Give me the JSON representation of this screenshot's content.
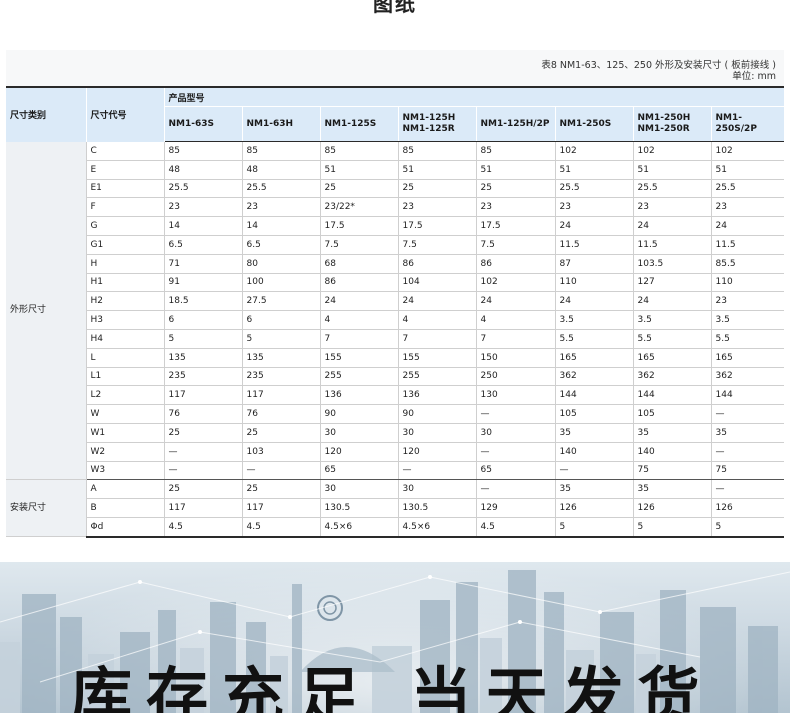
{
  "page_title": "图纸",
  "caption": {
    "title": "表8 NM1-63、125、250 外形及安装尺寸 ( 板前接线 )",
    "unit": "单位:  mm"
  },
  "header": {
    "category_label": "尺寸类别",
    "code_label": "尺寸代号",
    "group_label": "产品型号",
    "models": [
      "NM1-63S",
      "NM1-63H",
      "NM1-125S",
      "NM1-125H NM1-125R",
      "NM1-125H/2P",
      "NM1-250S",
      "NM1-250H NM1-250R",
      "NM1-250S/2P"
    ]
  },
  "sections": [
    {
      "category": "外形尺寸",
      "rows": [
        {
          "code": "C",
          "values": [
            "85",
            "85",
            "85",
            "85",
            "85",
            "102",
            "102",
            "102"
          ]
        },
        {
          "code": "E",
          "values": [
            "48",
            "48",
            "51",
            "51",
            "51",
            "51",
            "51",
            "51"
          ]
        },
        {
          "code": "E1",
          "values": [
            "25.5",
            "25.5",
            "25",
            "25",
            "25",
            "25.5",
            "25.5",
            "25.5"
          ]
        },
        {
          "code": "F",
          "values": [
            "23",
            "23",
            "23/22*",
            "23",
            "23",
            "23",
            "23",
            "23"
          ]
        },
        {
          "code": "G",
          "values": [
            "14",
            "14",
            "17.5",
            "17.5",
            "17.5",
            "24",
            "24",
            "24"
          ]
        },
        {
          "code": "G1",
          "values": [
            "6.5",
            "6.5",
            "7.5",
            "7.5",
            "7.5",
            "11.5",
            "11.5",
            "11.5"
          ]
        },
        {
          "code": "H",
          "values": [
            "71",
            "80",
            "68",
            "86",
            "86",
            "87",
            "103.5",
            "85.5"
          ]
        },
        {
          "code": "H1",
          "values": [
            "91",
            "100",
            "86",
            "104",
            "102",
            "110",
            "127",
            "110"
          ]
        },
        {
          "code": "H2",
          "values": [
            "18.5",
            "27.5",
            "24",
            "24",
            "24",
            "24",
            "24",
            "23"
          ]
        },
        {
          "code": "H3",
          "values": [
            "6",
            "6",
            "4",
            "4",
            "4",
            "3.5",
            "3.5",
            "3.5"
          ]
        },
        {
          "code": "H4",
          "values": [
            "5",
            "5",
            "7",
            "7",
            "7",
            "5.5",
            "5.5",
            "5.5"
          ]
        },
        {
          "code": "L",
          "values": [
            "135",
            "135",
            "155",
            "155",
            "150",
            "165",
            "165",
            "165"
          ]
        },
        {
          "code": "L1",
          "values": [
            "235",
            "235",
            "255",
            "255",
            "250",
            "362",
            "362",
            "362"
          ]
        },
        {
          "code": "L2",
          "values": [
            "117",
            "117",
            "136",
            "136",
            "130",
            "144",
            "144",
            "144"
          ]
        },
        {
          "code": "W",
          "values": [
            "76",
            "76",
            "90",
            "90",
            "—",
            "105",
            "105",
            "—"
          ]
        },
        {
          "code": "W1",
          "values": [
            "25",
            "25",
            "30",
            "30",
            "30",
            "35",
            "35",
            "35"
          ]
        },
        {
          "code": "W2",
          "values": [
            "—",
            "103",
            "120",
            "120",
            "—",
            "140",
            "140",
            "—"
          ]
        },
        {
          "code": "W3",
          "values": [
            "—",
            "—",
            "65",
            "—",
            "65",
            "—",
            "75",
            "75"
          ]
        }
      ]
    },
    {
      "category": "安装尺寸",
      "rows": [
        {
          "code": "A",
          "values": [
            "25",
            "25",
            "30",
            "30",
            "—",
            "35",
            "35",
            "—"
          ]
        },
        {
          "code": "B",
          "values": [
            "117",
            "117",
            "130.5",
            "130.5",
            "129",
            "126",
            "126",
            "126"
          ]
        },
        {
          "code": "Φd",
          "values": [
            "4.5",
            "4.5",
            "4.5×6",
            "4.5×6",
            "4.5",
            "5",
            "5",
            "5"
          ]
        }
      ]
    }
  ],
  "banner": {
    "headline": "库存充足 当天发货"
  }
}
